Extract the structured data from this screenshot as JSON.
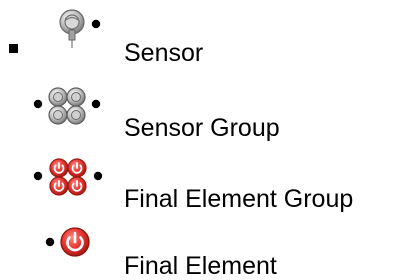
{
  "legend": {
    "items": [
      {
        "label": "Sensor",
        "icon": "sensor-icon"
      },
      {
        "label": "Sensor Group",
        "icon": "sensor-group-icon"
      },
      {
        "label": "Final Element Group",
        "icon": "final-element-group-icon"
      },
      {
        "label": "Final Element",
        "icon": "final-element-icon"
      }
    ]
  },
  "colors": {
    "text": "#000000",
    "sensor_gray": "#8c8c8c",
    "final_red": "#d9261c",
    "dot": "#000000"
  }
}
